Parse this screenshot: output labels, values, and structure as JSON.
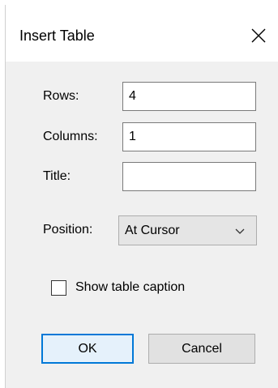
{
  "dialog": {
    "title": "Insert Table",
    "close_icon": "close-icon"
  },
  "form": {
    "rows_label": "Rows:",
    "rows_value": "4",
    "columns_label": "Columns:",
    "columns_value": "1",
    "title_label": "Title:",
    "title_value": "",
    "position_label": "Position:",
    "position_value": "At Cursor",
    "position_arrow_icon": "chevron-down-icon",
    "show_caption_label": "Show table caption",
    "show_caption_checked": false
  },
  "buttons": {
    "ok_label": "OK",
    "cancel_label": "Cancel"
  },
  "colors": {
    "accent": "#0078d7",
    "dialog_background": "#f0f0f0"
  }
}
